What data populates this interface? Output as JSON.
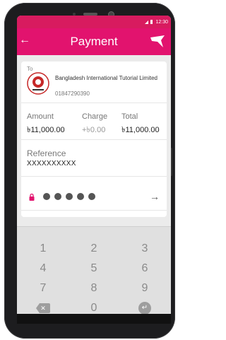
{
  "status_bar": {
    "time": "12:30"
  },
  "appbar": {
    "back_icon": "←",
    "title": "Payment"
  },
  "recipient": {
    "to_label": "To",
    "name": "Bangladesh International Tutorial Limited",
    "phone": "01847290390"
  },
  "amounts": {
    "amount_label": "Amount",
    "amount_value": "৳11,000.00",
    "charge_label": "Charge",
    "charge_value": "+৳0.00",
    "total_label": "Total",
    "total_value": "৳11,000.00"
  },
  "reference": {
    "label": "Reference",
    "value": "XXXXXXXXXX"
  },
  "pin": {
    "dot_count": 5,
    "submit_icon": "→"
  },
  "keypad": {
    "keys": [
      "1",
      "2",
      "3",
      "4",
      "5",
      "6",
      "7",
      "8",
      "9",
      "0"
    ],
    "backspace_icon": "✕",
    "enter_icon": "↵"
  },
  "colors": {
    "brand": "#e2136e",
    "status": "#d81b5f"
  },
  "icons": {
    "back": "arrow-left-icon",
    "brand": "bird-logo-icon",
    "lock": "lock-icon",
    "submit": "arrow-right-icon"
  }
}
